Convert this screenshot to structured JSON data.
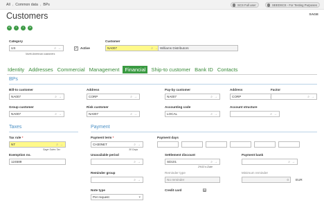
{
  "breadcrumb": {
    "items": [
      "All",
      "Common data",
      "BPs"
    ]
  },
  "user_pills": {
    "user": "SCS Full user",
    "folder": "SEEDSCS - For Testing Purposes"
  },
  "page": {
    "title": "Customers",
    "brand": "SAGE"
  },
  "header": {
    "category": {
      "label": "Category",
      "value": "US",
      "sub": "North American customers"
    },
    "active": {
      "label": "Active",
      "checked": true
    },
    "customer": {
      "label": "Customer",
      "value": "NA007",
      "name": "Williams Distributors"
    }
  },
  "tabs": [
    "Identity",
    "Addresses",
    "Commercial",
    "Management",
    "Financial",
    "Ship-to customer",
    "Bank ID",
    "Contacts"
  ],
  "active_tab": "Financial",
  "bps": {
    "title": "BPs",
    "bill_to": {
      "label": "Bill-to customer",
      "value": "NA007"
    },
    "address1": {
      "label": "Address",
      "value": "CORP"
    },
    "pay_by": {
      "label": "Pay-by customer",
      "value": "NA007"
    },
    "address2": {
      "label": "Address",
      "value": "CORP"
    },
    "factor": {
      "label": "Factor",
      "value": ""
    },
    "group": {
      "label": "Group customer",
      "value": "NA007"
    },
    "risk": {
      "label": "Risk customer",
      "value": "NA007"
    },
    "accounting": {
      "label": "Accounting code",
      "value": "LOCAL"
    },
    "account_structure": {
      "label": "Account structure",
      "value": ""
    }
  },
  "taxes": {
    "title": "Taxes",
    "tax_rule": {
      "label": "Tax rule",
      "value": "NT",
      "sub": "Sage Sales Tax"
    },
    "exemption": {
      "label": "Exemption no.",
      "value": "124589"
    }
  },
  "payment": {
    "title": "Payment",
    "term": {
      "label": "Payment term",
      "value": "CH30NET",
      "sub": "30 Days"
    },
    "days": {
      "label": "Payment days"
    },
    "unavailable": {
      "label": "Unavailable period",
      "value": ""
    },
    "settlement": {
      "label": "Settlement discount",
      "value": "SD101",
      "sub": "2%10 n-Date"
    },
    "bank": {
      "label": "Payment bank",
      "value": ""
    },
    "reminder_group": {
      "label": "Reminder group",
      "value": ""
    },
    "reminder_type": {
      "label": "Reminder type",
      "value": "No reminder"
    },
    "min_reminder": {
      "label": "Minimum reminder",
      "value": "0",
      "currency": "EUR"
    },
    "note_type": {
      "label": "Note type",
      "value": "Per request"
    },
    "credit_card": {
      "label": "Credit card"
    }
  },
  "colors": {
    "accent_green": "#3a9a42",
    "section_blue": "#4a8fc4",
    "highlight": "#fff98a"
  }
}
